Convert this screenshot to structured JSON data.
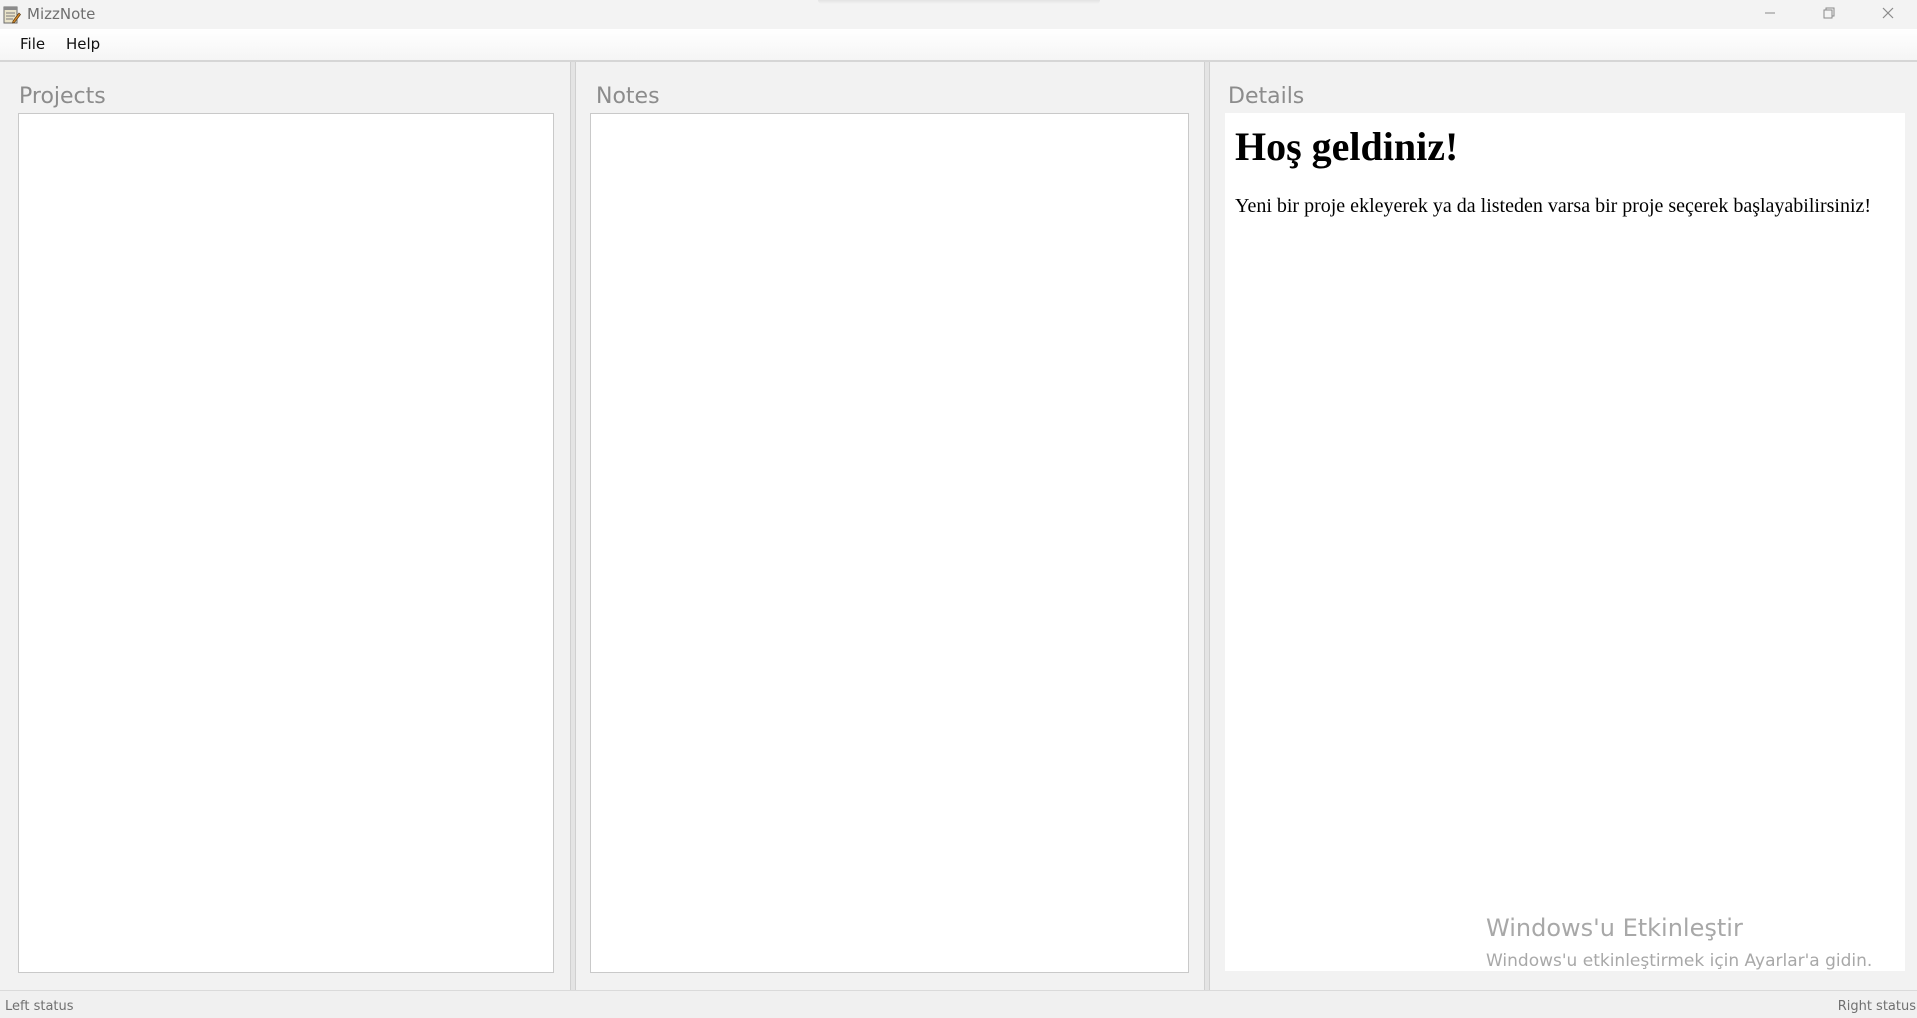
{
  "window": {
    "title": "MizzNote",
    "icon": "notepad-icon",
    "controls": [
      "minimize-icon",
      "restore-icon",
      "close-icon"
    ]
  },
  "menu": {
    "items": [
      {
        "label": "File"
      },
      {
        "label": "Help"
      }
    ]
  },
  "panels": {
    "projects": {
      "title": "Projects"
    },
    "notes": {
      "title": "Notes"
    },
    "details": {
      "title": "Details",
      "heading": "Hoş geldiniz!",
      "body": "Yeni bir proje ekleyerek ya da listeden varsa bir proje seçerek başlayabilirsiniz!"
    }
  },
  "watermark": {
    "title": "Windows'u Etkinleştir",
    "subtitle": "Windows'u etkinleştirmek için Ayarlar'a gidin."
  },
  "status": {
    "left": "Left status",
    "right": "Right status"
  }
}
